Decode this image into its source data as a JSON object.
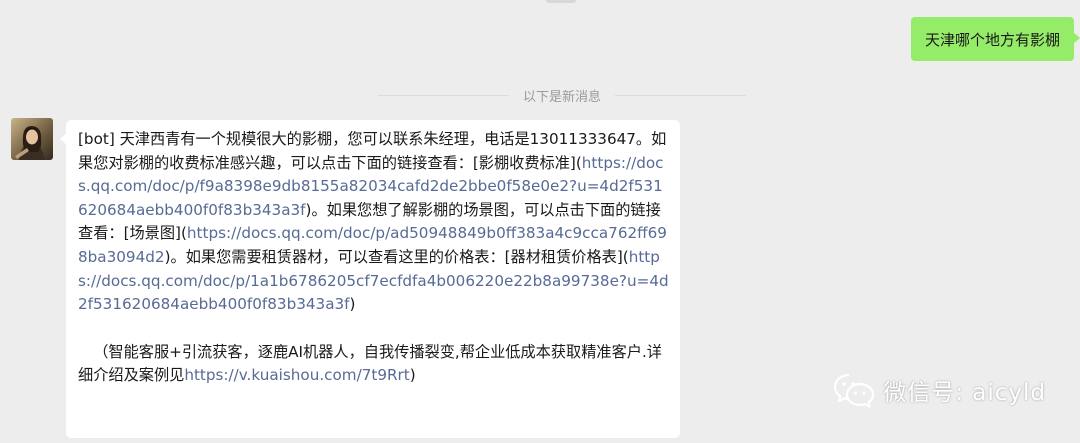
{
  "chat": {
    "user_message": "天津哪个地方有影棚",
    "divider_text": "以下是新消息",
    "bot": {
      "avatar_icon": "avatar-portrait",
      "tag": "[bot]",
      "t1": " 天津西青有一个规模很大的影棚，您可以联系朱经理，电话是13011333647。如果您对影棚的收费标准感兴趣，可以点击下面的链接查看：[影棚收费标准](",
      "l1": "https://docs.qq.com/doc/p/f9a8398e9db8155a82034cafd2de2bbe0f58e0e2?u=4d2f531620684aebb400f0f83b343a3f",
      "t2": ")。如果您想了解影棚的场景图，可以点击下面的链接查看：[场景图](",
      "l2": "https://docs.qq.com/doc/p/ad50948849b0ff383a4c9cca762ff698ba3094d2",
      "t3": ")。如果您需要租赁器材，可以查看这里的价格表：[器材租赁价格表](",
      "l3": "https://docs.qq.com/doc/p/1a1b6786205cf7ecfdfa4b006220e22b8a99738e?u=4d2f531620684aebb400f0f83b343a3f",
      "t4": ")",
      "ad_text": "（智能客服+引流获客，逐鹿AI机器人，自我传播裂变,帮企业低成本获取精准客户.详细介绍及案例见",
      "ad_link": "https://v.kuaishou.com/7t9Rrt",
      "ad_end": ")"
    }
  },
  "watermark": {
    "icon": "wechat-icon",
    "text": "微信号: aicyld"
  },
  "colors": {
    "background": "#ededed",
    "user_bubble": "#95ec69",
    "bot_bubble": "#ffffff",
    "link": "#576b95"
  }
}
